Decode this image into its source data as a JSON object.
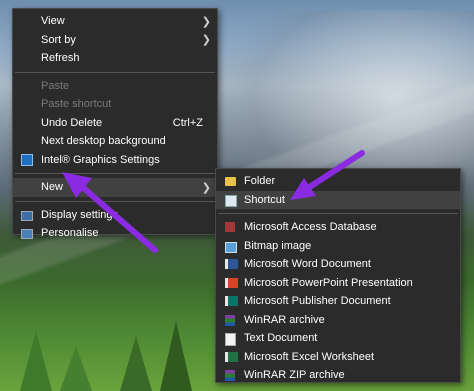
{
  "context_menu": {
    "items": [
      {
        "label": "View",
        "submenu": true
      },
      {
        "label": "Sort by",
        "submenu": true
      },
      {
        "label": "Refresh"
      },
      {
        "label": "Paste",
        "disabled": true
      },
      {
        "label": "Paste shortcut",
        "disabled": true
      },
      {
        "label": "Undo Delete",
        "shortcut": "Ctrl+Z"
      },
      {
        "label": "Next desktop background"
      },
      {
        "label": "Intel® Graphics Settings",
        "icon": "intel-graphics-icon"
      },
      {
        "label": "New",
        "submenu": true,
        "highlighted": true
      },
      {
        "label": "Display settings",
        "icon": "display-icon"
      },
      {
        "label": "Personalise",
        "icon": "personalise-icon"
      }
    ]
  },
  "new_submenu": {
    "items": [
      {
        "label": "Folder",
        "icon": "folder-icon"
      },
      {
        "label": "Shortcut",
        "icon": "shortcut-icon",
        "highlighted": true
      },
      {
        "label": "Microsoft Access Database",
        "icon": "access-icon"
      },
      {
        "label": "Bitmap image",
        "icon": "bitmap-icon"
      },
      {
        "label": "Microsoft Word Document",
        "icon": "word-icon"
      },
      {
        "label": "Microsoft PowerPoint Presentation",
        "icon": "powerpoint-icon"
      },
      {
        "label": "Microsoft Publisher Document",
        "icon": "publisher-icon"
      },
      {
        "label": "WinRAR archive",
        "icon": "winrar-icon"
      },
      {
        "label": "Text Document",
        "icon": "text-document-icon"
      },
      {
        "label": "Microsoft Excel Worksheet",
        "icon": "excel-icon"
      },
      {
        "label": "WinRAR ZIP archive",
        "icon": "winrar-zip-icon"
      }
    ]
  },
  "colors": {
    "menu_bg": "#2b2b2b",
    "highlight": "#414141",
    "annotation_arrow": "#8a2be2"
  }
}
